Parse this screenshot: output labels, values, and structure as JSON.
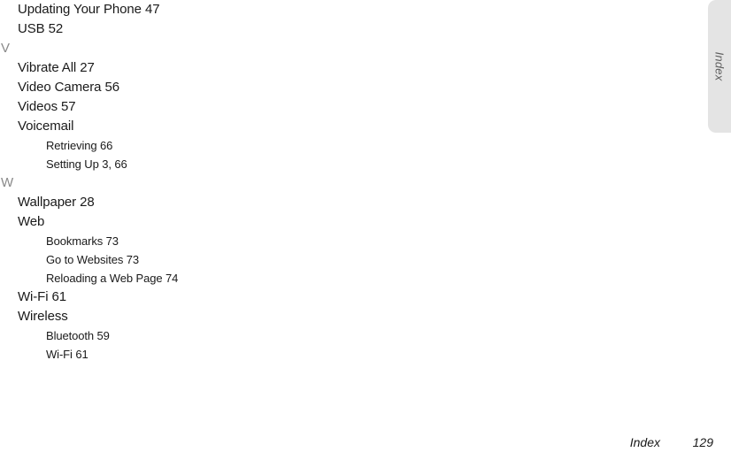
{
  "side_tab": {
    "label": "Index",
    "background_color": "#e4e4e4",
    "text_color": "#5e5e5e"
  },
  "index": {
    "lines": [
      {
        "type": "entry",
        "text": "Updating Your Phone 47"
      },
      {
        "type": "entry",
        "text": "USB 52"
      },
      {
        "type": "letter",
        "text": "V"
      },
      {
        "type": "entry",
        "text": "Vibrate All 27"
      },
      {
        "type": "entry",
        "text": "Video Camera 56"
      },
      {
        "type": "entry",
        "text": "Videos 57"
      },
      {
        "type": "entry",
        "text": "Voicemail"
      },
      {
        "type": "subentry",
        "text": "Retrieving 66"
      },
      {
        "type": "subentry",
        "text": "Setting Up 3, 66"
      },
      {
        "type": "letter",
        "text": "W"
      },
      {
        "type": "entry",
        "text": "Wallpaper 28"
      },
      {
        "type": "entry",
        "text": "Web"
      },
      {
        "type": "subentry",
        "text": "Bookmarks 73"
      },
      {
        "type": "subentry",
        "text": "Go to Websites 73"
      },
      {
        "type": "subentry",
        "text": "Reloading a Web Page 74"
      },
      {
        "type": "entry",
        "text": "Wi-Fi 61"
      },
      {
        "type": "entry",
        "text": "Wireless"
      },
      {
        "type": "subentry",
        "text": "Bluetooth 59"
      },
      {
        "type": "subentry",
        "text": "Wi-Fi 61"
      }
    ]
  },
  "footer": {
    "label": "Index",
    "page_number": "129"
  }
}
